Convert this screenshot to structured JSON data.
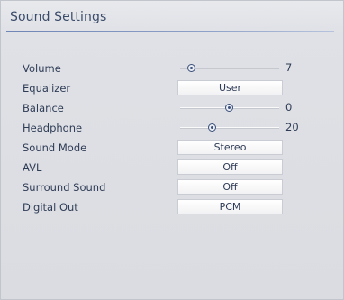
{
  "title": "Sound Settings",
  "settings": [
    {
      "label": "Volume",
      "type": "slider",
      "value": "7",
      "level": 0.12
    },
    {
      "label": "Equalizer",
      "type": "option",
      "value": "User"
    },
    {
      "label": "Balance",
      "type": "slider",
      "value": "0",
      "level": 0.5
    },
    {
      "label": "Headphone",
      "type": "slider",
      "value": "20",
      "level": 0.33
    },
    {
      "label": "Sound Mode",
      "type": "option",
      "value": "Stereo"
    },
    {
      "label": "AVL",
      "type": "option",
      "value": "Off"
    },
    {
      "label": "Surround Sound",
      "type": "option",
      "value": "Off"
    },
    {
      "label": "Digital Out",
      "type": "option",
      "value": "PCM"
    }
  ]
}
